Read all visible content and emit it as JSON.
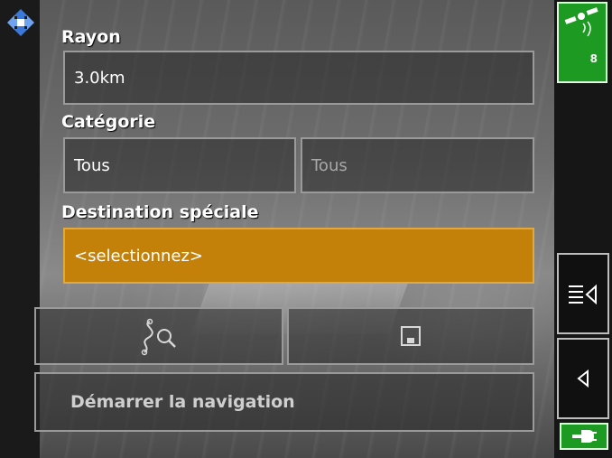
{
  "form": {
    "radius_label": "Rayon",
    "radius_value": "3.0km",
    "category_label": "Catégorie",
    "category_value": "Tous",
    "subcategory_value": "Tous",
    "poi_label": "Destination spéciale",
    "poi_value": "<selectionnez>"
  },
  "actions": {
    "start_navigation_label": "Démarrer la navigation"
  },
  "status": {
    "satellite_count": "8"
  },
  "colors": {
    "selected_field": "#c4810a",
    "gps_green": "#1c9a22"
  },
  "icons": {
    "logo": "navigation-logo-icon",
    "route_search": "route-search-icon",
    "save": "save-icon",
    "menu": "menu-collapse-icon",
    "back": "back-arrow-icon",
    "gps": "satellite-icon",
    "power": "power-plug-icon"
  }
}
